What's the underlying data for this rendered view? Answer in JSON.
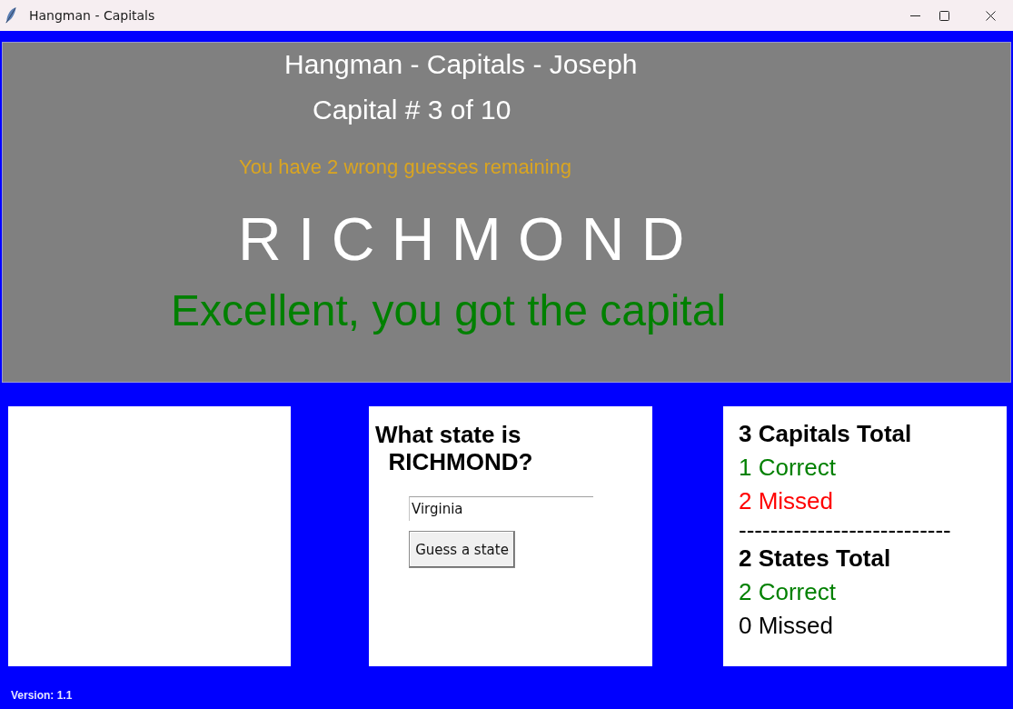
{
  "window": {
    "title": "Hangman - Capitals"
  },
  "header": {
    "title": "Hangman - Capitals - Joseph",
    "counter": "Capital # 3 of 10",
    "remaining": "You have 2 wrong guesses remaining",
    "word": "R I C H M O N D",
    "result": "Excellent, you got the capital"
  },
  "question": {
    "prompt": "What state is\n  RICHMOND?",
    "input": {
      "value": "Virginia"
    },
    "button": "Guess a state"
  },
  "stats": [
    {
      "kind": "total",
      "text": "3 Capitals Total"
    },
    {
      "kind": "count",
      "text": "1 Correct",
      "color": "#008000"
    },
    {
      "kind": "count",
      "text": "2 Missed",
      "color": "#ff0000"
    },
    {
      "kind": "divider",
      "text": "---------------------------"
    },
    {
      "kind": "total",
      "text": "2 States Total"
    },
    {
      "kind": "count",
      "text": "2 Correct",
      "color": "#008000"
    },
    {
      "kind": "count",
      "text": "0 Missed",
      "color": "#000000"
    }
  ],
  "version": "Version: 1.1"
}
